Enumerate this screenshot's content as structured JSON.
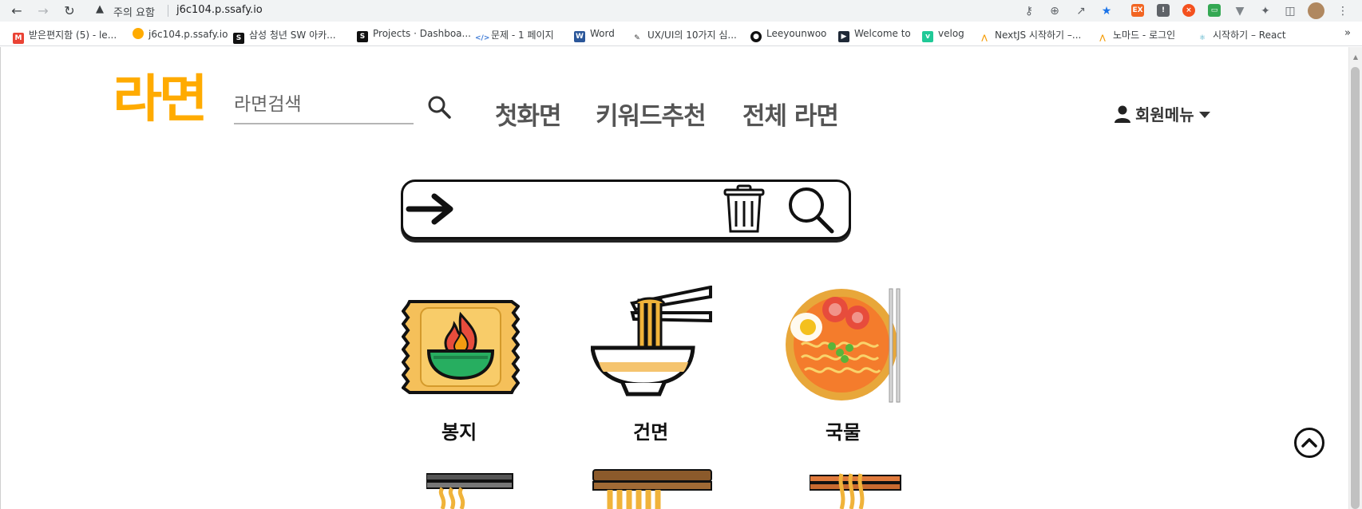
{
  "browser": {
    "security_warning": "주의 요함",
    "url": "j6c104.p.ssafy.io",
    "bookmarks": [
      {
        "label": "받은편지함 (5) - le...",
        "icon": "gmail-icon",
        "color": "#ea4335"
      },
      {
        "label": "j6c104.p.ssafy.io",
        "icon": "ramen-site-icon",
        "color": "#ffab00"
      },
      {
        "label": "삼성 청년 SW 아카...",
        "icon": "ssafy-icon",
        "color": "#111111"
      },
      {
        "label": "Projects · Dashboa...",
        "icon": "ssafy-icon",
        "color": "#111111"
      },
      {
        "label": "문제 - 1 페이지",
        "icon": "code-icon",
        "color": "#3d7ad6"
      },
      {
        "label": "Word",
        "icon": "word-icon",
        "color": "#2b579a"
      },
      {
        "label": "UX/UI의 10가지 심...",
        "icon": "pen-icon",
        "color": "#333333"
      },
      {
        "label": "Leeyounwoo",
        "icon": "github-icon",
        "color": "#111111"
      },
      {
        "label": "Welcome to",
        "icon": "app-icon",
        "color": "#1f2937"
      },
      {
        "label": "velog",
        "icon": "velog-icon",
        "color": "#20c997"
      },
      {
        "label": "NextJS 시작하기 –...",
        "icon": "nomad-icon",
        "color": "#f59e0b"
      },
      {
        "label": "노마드 - 로그인",
        "icon": "nomad-icon",
        "color": "#f59e0b"
      },
      {
        "label": "시작하기 – React",
        "icon": "react-icon",
        "color": "#61dafb"
      }
    ],
    "bookmarks_more": "»"
  },
  "header": {
    "logo": "라면",
    "search_placeholder": "라면검색",
    "nav": [
      "첫화면",
      "키워드추천",
      "전체 라면"
    ],
    "member_menu": "회원메뉴"
  },
  "categories": [
    {
      "label": "봉지",
      "icon": "ramen-packet-icon"
    },
    {
      "label": "건면",
      "icon": "dry-noodle-bowl-icon"
    },
    {
      "label": "국물",
      "icon": "soup-ramen-icon"
    }
  ],
  "colors": {
    "brand": "#ffab00",
    "nav_text": "#555555"
  }
}
